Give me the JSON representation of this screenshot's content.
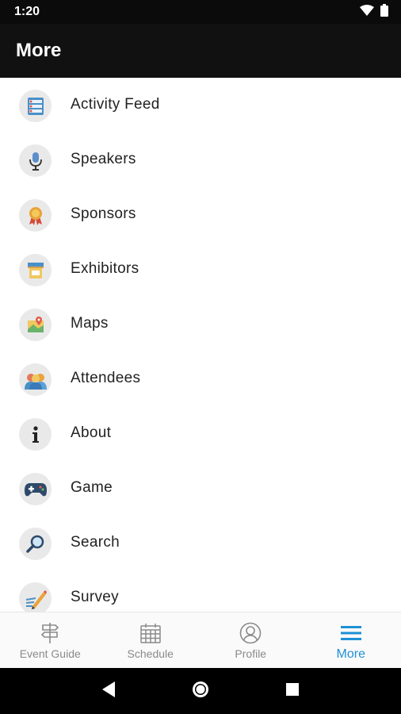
{
  "status_bar": {
    "time": "1:20",
    "icons": [
      "wifi-icon",
      "battery-icon"
    ]
  },
  "app_bar": {
    "title": "More"
  },
  "menu": {
    "items": [
      {
        "label": "Activity Feed",
        "icon": "activity-feed-icon"
      },
      {
        "label": "Speakers",
        "icon": "microphone-icon"
      },
      {
        "label": "Sponsors",
        "icon": "ribbon-award-icon"
      },
      {
        "label": "Exhibitors",
        "icon": "booth-icon"
      },
      {
        "label": "Maps",
        "icon": "map-pin-icon"
      },
      {
        "label": "Attendees",
        "icon": "people-icon"
      },
      {
        "label": "About",
        "icon": "info-icon"
      },
      {
        "label": "Game",
        "icon": "gamepad-icon"
      },
      {
        "label": "Search",
        "icon": "magnifier-icon"
      },
      {
        "label": "Survey",
        "icon": "pencil-paper-icon"
      }
    ]
  },
  "bottom_nav": {
    "active_color": "#1e90d6",
    "tabs": [
      {
        "label": "Event Guide",
        "icon": "signpost-icon",
        "active": false
      },
      {
        "label": "Schedule",
        "icon": "calendar-icon",
        "active": false
      },
      {
        "label": "Profile",
        "icon": "person-circle-icon",
        "active": false
      },
      {
        "label": "More",
        "icon": "hamburger-menu-icon",
        "active": true
      }
    ]
  },
  "system_nav": {
    "buttons": [
      "back-icon",
      "home-icon",
      "recents-icon"
    ]
  }
}
